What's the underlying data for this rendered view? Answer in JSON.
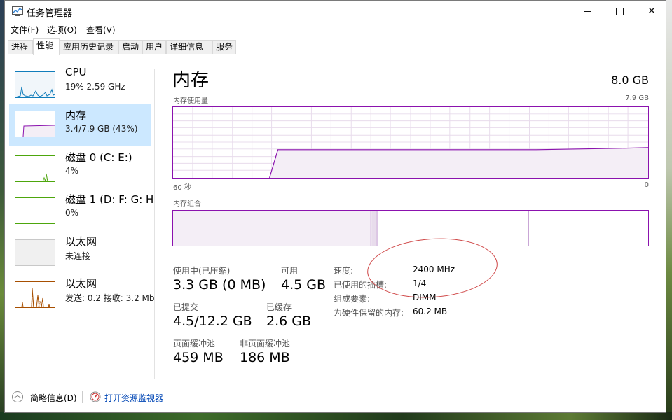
{
  "window": {
    "title": "任务管理器"
  },
  "menu": [
    "文件(F)",
    "选项(O)",
    "查看(V)"
  ],
  "tabs": [
    "进程",
    "性能",
    "应用历史记录",
    "启动",
    "用户",
    "详细信息",
    "服务"
  ],
  "active_tab": "性能",
  "sidebar": [
    {
      "name": "CPU",
      "sub": "19% 2.59 GHz",
      "color": "#117dbb"
    },
    {
      "name": "内存",
      "sub": "3.4/7.9 GB (43%)",
      "color": "#8b12ae"
    },
    {
      "name": "磁盘 0 (C: E:)",
      "sub": "4%",
      "color": "#4da60c"
    },
    {
      "name": "磁盘 1 (D: F: G: H",
      "sub": "0%",
      "color": "#4da60c"
    },
    {
      "name": "以太网",
      "sub": "未连接",
      "color": "#a5a5a5"
    },
    {
      "name": "以太网",
      "sub": "发送: 0.2  接收: 3.2 Mb",
      "color": "#a74f01"
    }
  ],
  "main": {
    "title": "内存",
    "total": "8.0 GB",
    "usage_label": "内存使用量",
    "usage_max": "7.9 GB",
    "time_left": "60 秒",
    "time_right": "0",
    "composition_label": "内存组合",
    "usage_fraction": 0.43
  },
  "stats": {
    "in_use_label": "使用中(已压缩)",
    "in_use": "3.3 GB (0 MB)",
    "available_label": "可用",
    "available": "4.5 GB",
    "committed_label": "已提交",
    "committed": "4.5/12.2 GB",
    "cached_label": "已缓存",
    "cached": "2.6 GB",
    "paged_label": "页面缓冲池",
    "paged": "459 MB",
    "nonpaged_label": "非页面缓冲池",
    "nonpaged": "186 MB"
  },
  "details": [
    {
      "key": "速度:",
      "value": "2400 MHz"
    },
    {
      "key": "已使用的插槽:",
      "value": "1/4"
    },
    {
      "key": "组成要素:",
      "value": "DIMM"
    },
    {
      "key": "为硬件保留的内存:",
      "value": "60.2 MB"
    }
  ],
  "footer": {
    "fewer_details": "简略信息(D)",
    "open_monitor": "打开资源监视器"
  },
  "colors": {
    "memory": "#8b12ae",
    "selected": "#cce8ff",
    "link": "#0046b5"
  }
}
